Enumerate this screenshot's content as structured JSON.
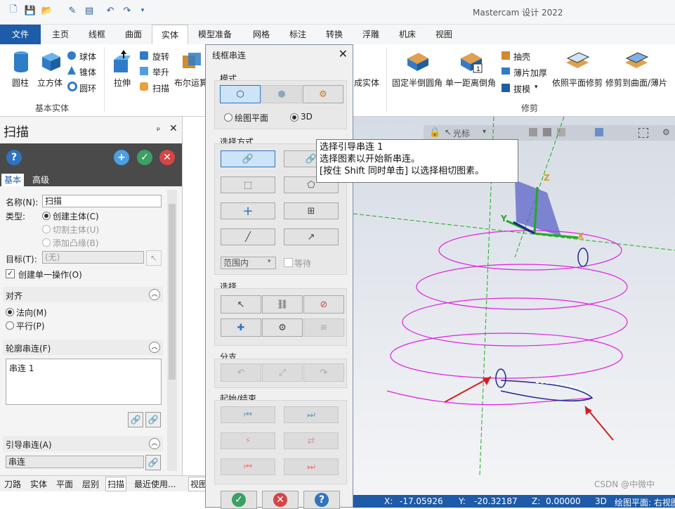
{
  "app": {
    "title": "Mastercam 设计 2022"
  },
  "ribbon_tabs": [
    {
      "label": "文件"
    },
    {
      "label": "主页"
    },
    {
      "label": "线框"
    },
    {
      "label": "曲面"
    },
    {
      "label": "实体"
    },
    {
      "label": "模型准备"
    },
    {
      "label": "网格"
    },
    {
      "label": "标注"
    },
    {
      "label": "转换"
    },
    {
      "label": "浮雕"
    },
    {
      "label": "机床"
    },
    {
      "label": "视图"
    }
  ],
  "ribbon": {
    "basic_solids": {
      "label": "基本实体",
      "cylinder": "圆柱",
      "cube": "立方体",
      "sphere": "球体",
      "cone": "锥体",
      "torus": "圆环"
    },
    "create": {
      "extrude": "拉伸",
      "revolve": "旋转",
      "loft": "举升",
      "sweep": "扫描",
      "boolean": "布尔运算",
      "generate_solid": "成实体"
    },
    "modify": {
      "label": "修剪",
      "fixed_fillet": "固定半倒圆角",
      "single_chamfer": "单一距离倒角",
      "shell": "抽壳",
      "thicken": "薄片加厚",
      "draft": "拔模",
      "trim_plane": "依照平面修剪",
      "trim_surface": "修剪到曲面/薄片"
    }
  },
  "left_panel": {
    "title": "扫描",
    "pin": "ᵖ",
    "tabs": [
      "基本",
      "高级"
    ],
    "name_label": "名称(N):",
    "name_value": "扫描",
    "type_label": "类型:",
    "type_options": [
      "创建主体(C)",
      "切割主体(U)",
      "添加凸缘(B)"
    ],
    "target_label": "目标(T):",
    "target_value": "(无)",
    "single_op_label": "创建单一操作(O)",
    "align_section": "对齐",
    "align_options": [
      "法向(M)",
      "平行(P)"
    ],
    "profile_section": "轮廓串连(F)",
    "profile_items": [
      "串连 1"
    ],
    "guide_section": "引导串连(A)",
    "guide_value": "串连"
  },
  "bottom_tabs": [
    "刀路",
    "实体",
    "平面",
    "层别",
    "扫描",
    "最近使用..."
  ],
  "view_tab": "视图",
  "dialog": {
    "title": "线框串连",
    "mode_label": "模式",
    "mode_plane": "绘图平面",
    "mode_3d": "3D",
    "select_method_label": "选择方式",
    "range_label": "范围内",
    "equal_label": "等待",
    "select_label": "选择",
    "branch_label": "分支",
    "start_end_label": "起始/结束"
  },
  "tooltip": {
    "line1": "选择引导串连 1",
    "line2": "选择图素以开始新串连。",
    "line3": "[按住 Shift 同时单击] 以选择相切图素。"
  },
  "viewport": {
    "toolbar_cursor": "光标",
    "axis_x": "X",
    "axis_y": "Y",
    "axis_z": "Z"
  },
  "status": {
    "x_label": "X:",
    "x_value": "-17.05926",
    "y_label": "Y:",
    "y_value": "-20.32187",
    "z_label": "Z:",
    "z_value": "0.00000",
    "mode": "3D",
    "plane": "绘图平面: 右视图",
    "watermark": "CSDN @中微中"
  },
  "colors": {
    "accent": "#1e5ba8",
    "helix": "#e020e0",
    "axis_green": "#22aa22"
  }
}
